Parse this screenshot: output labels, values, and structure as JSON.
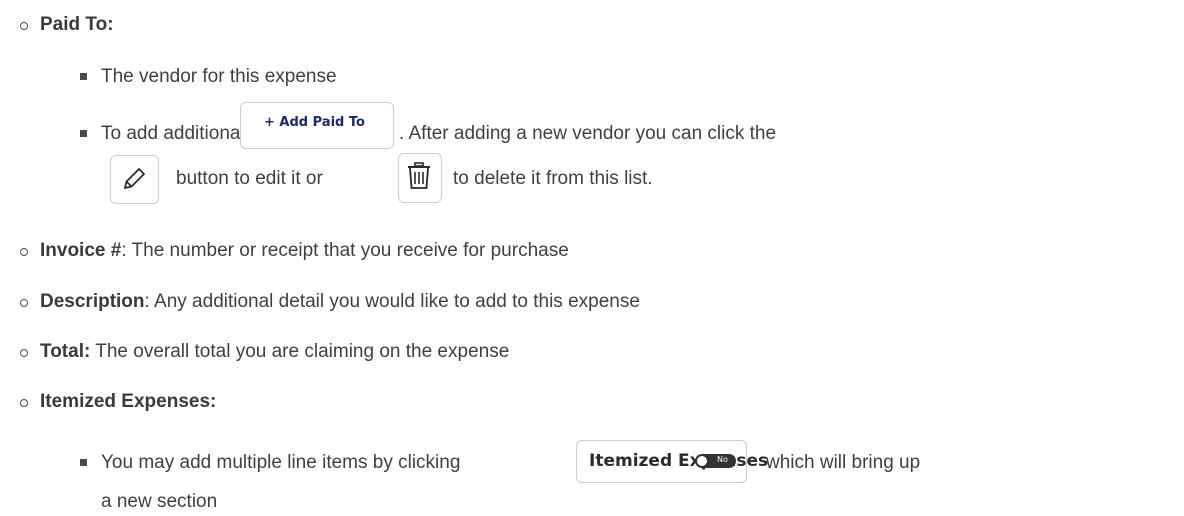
{
  "items": {
    "paid_to": {
      "label": "Paid To:"
    },
    "vendor_desc": {
      "text": "The vendor for this expense"
    },
    "add_vendors": {
      "text_before": "To add additional vendors click",
      "button_label": "+ Add Paid To",
      "text_after": ". After adding a new vendor you can click the",
      "text_mid": "button to edit it or",
      "text_end": "to delete it from this list.",
      "pencil_icon": "pencil-icon",
      "trash_icon": "trash-icon"
    },
    "invoice": {
      "label": "Invoice #",
      "text": ": The number or receipt that you receive for purchase"
    },
    "description": {
      "label": "Description",
      "text": ": Any additional detail you would like to add to this expense"
    },
    "total": {
      "label": "Total:",
      "text": " The overall total you are claiming on the expense"
    },
    "itemized": {
      "label": "Itemized Expenses:",
      "text_before": "You may add multiple line items by clicking",
      "button_label": "Itemized Expenses",
      "toggle_text": "No",
      "text_after": "which will bring up",
      "text_cont": "a new section"
    }
  },
  "colors": {
    "body_text": "#404040",
    "button_border": "#c9ccd1",
    "button_text": "#1d2b6b",
    "toggle_bg": "#333333"
  }
}
